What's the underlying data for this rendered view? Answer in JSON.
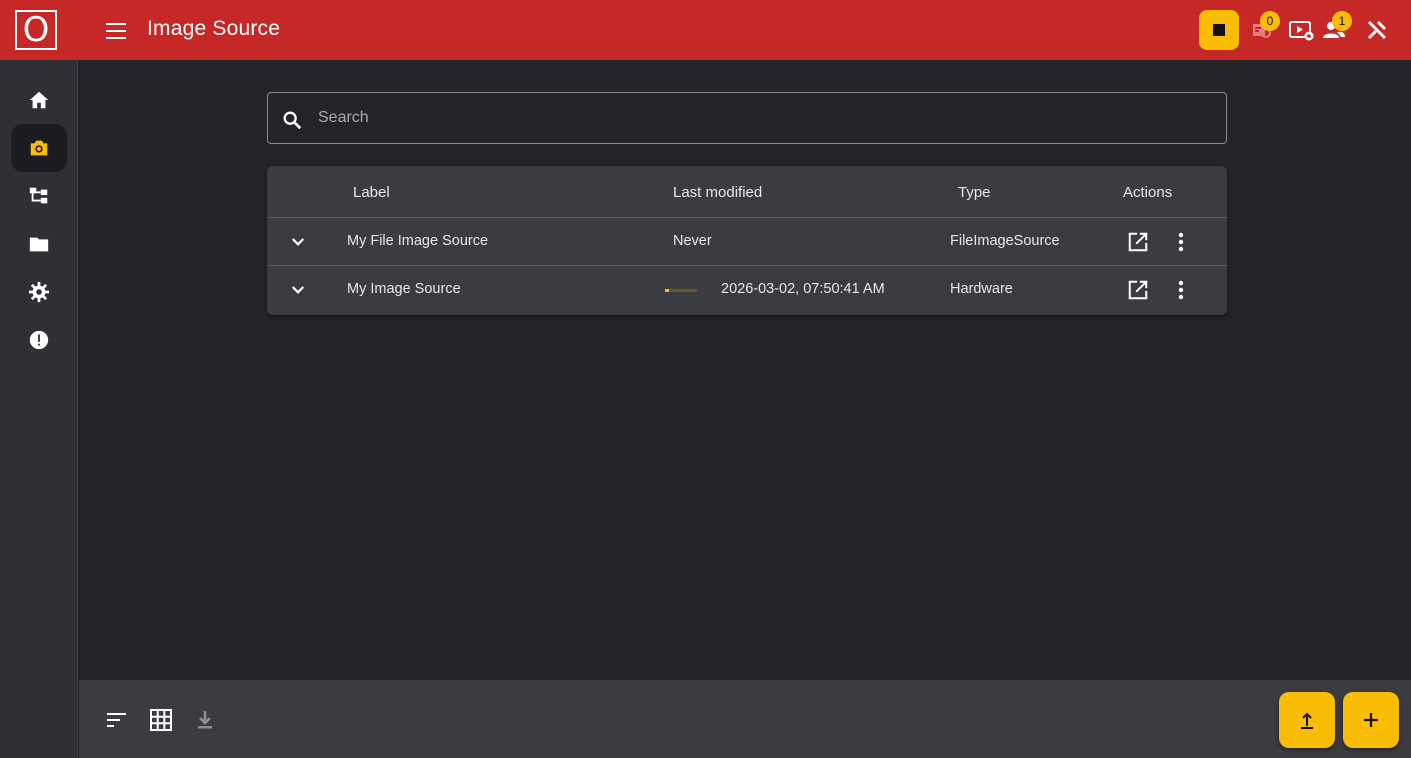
{
  "app": {
    "logo_letter": "O",
    "title": "Image Source"
  },
  "header_icons": {
    "stop": "stop-icon",
    "license_badge_count": "0",
    "users_badge_count": "1",
    "icons": [
      "license-icon",
      "video-settings-icon",
      "users-icon",
      "tools-icon"
    ],
    "accent": "#fbbc05",
    "brand": "#c62828"
  },
  "sidebar": {
    "items": [
      {
        "name": "home",
        "icon": "home-icon"
      },
      {
        "name": "image-source",
        "icon": "camera-icon",
        "active": true
      },
      {
        "name": "hierarchy",
        "icon": "hierarchy-icon"
      },
      {
        "name": "files",
        "icon": "folder-icon"
      },
      {
        "name": "settings",
        "icon": "gear-icon"
      },
      {
        "name": "alerts",
        "icon": "alert-icon"
      }
    ]
  },
  "search": {
    "placeholder": "Search",
    "value": ""
  },
  "table": {
    "headers": {
      "label": "Label",
      "last_modified": "Last modified",
      "type": "Type",
      "actions": "Actions"
    },
    "rows": [
      {
        "label": "My File Image Source",
        "last_modified": "Never",
        "type": "FileImageSource",
        "progress": null
      },
      {
        "label": "My Image Source",
        "last_modified": "2026-03-02, 07:50:41 AM",
        "type": "Hardware",
        "progress": 0.12
      }
    ]
  },
  "footer": {
    "icons": [
      "sort-icon",
      "grid-icon",
      "download-icon"
    ],
    "fabs": [
      "upload-icon",
      "add-icon"
    ]
  }
}
